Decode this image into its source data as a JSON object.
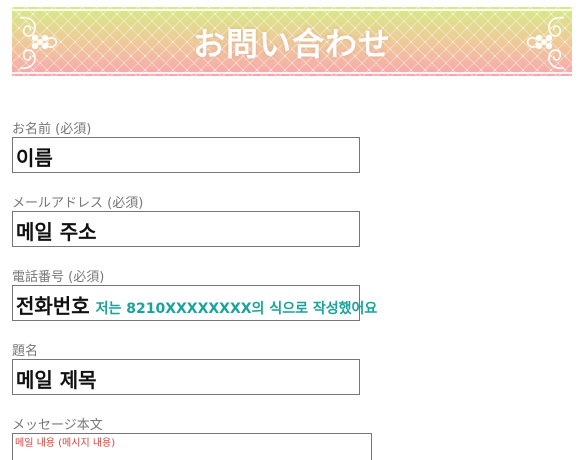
{
  "banner": {
    "title": "お問い合わせ"
  },
  "form": {
    "name": {
      "label": "お名前 (必須)",
      "value": "이름"
    },
    "email": {
      "label": "メールアドレス (必須)",
      "value": "메일 주소"
    },
    "phone": {
      "label": "電話番号 (必須)",
      "value": "전화번호",
      "note": "저는 8210XXXXXXXX의 식으로 작성했어요"
    },
    "subject": {
      "label": "題名",
      "value": "메일 제목"
    },
    "message": {
      "label": "メッセージ本文",
      "value": "메일 내용 (메시지 내용)"
    }
  },
  "colors": {
    "banner_top": "#d6ea86",
    "banner_bottom": "#f7a7ae",
    "note_color": "#1aa39a",
    "message_text_color": "#d9413a"
  }
}
